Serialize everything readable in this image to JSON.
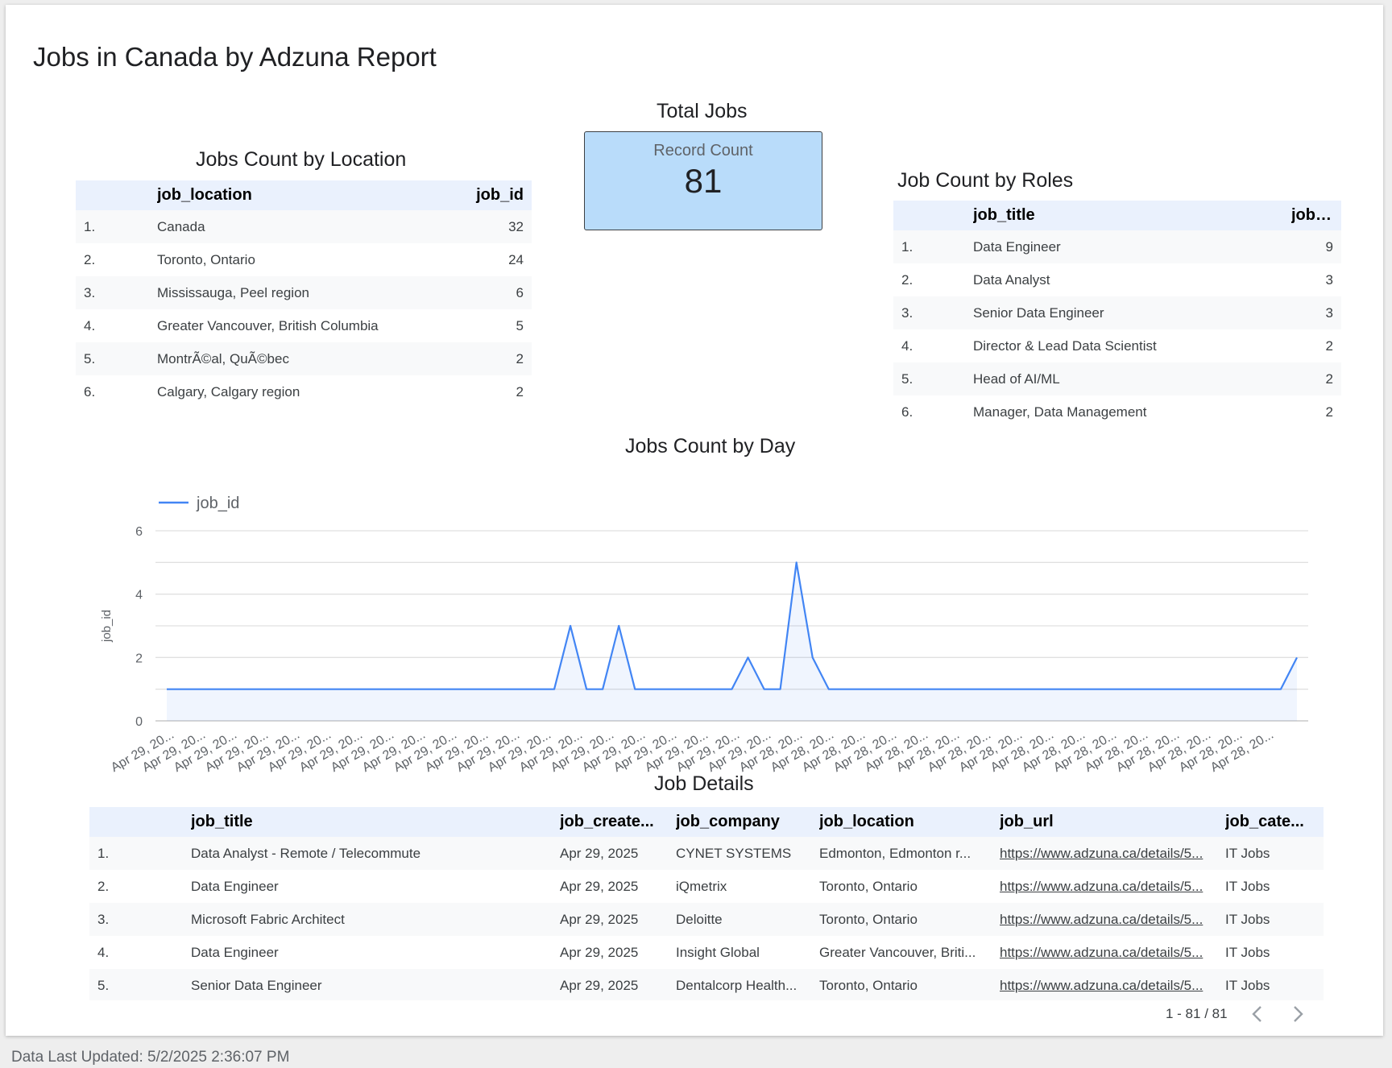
{
  "report": {
    "title": "Jobs in Canada by Adzuna Report",
    "footer": "Data Last Updated: 5/2/2025 2:36:07 PM"
  },
  "location_table": {
    "title": "Jobs Count by Location",
    "headers": [
      "job_location",
      "job_id"
    ],
    "rows": [
      {
        "idx": "1.",
        "location": "Canada",
        "count": "32"
      },
      {
        "idx": "2.",
        "location": "Toronto, Ontario",
        "count": "24"
      },
      {
        "idx": "3.",
        "location": "Mississauga, Peel region",
        "count": "6"
      },
      {
        "idx": "4.",
        "location": "Greater Vancouver, British Columbia",
        "count": "5"
      },
      {
        "idx": "5.",
        "location": "MontrÃ©al, QuÃ©bec",
        "count": "2"
      },
      {
        "idx": "6.",
        "location": "Calgary, Calgary region",
        "count": "2"
      }
    ]
  },
  "scorecard": {
    "title": "Total Jobs",
    "label": "Record Count",
    "value": "81"
  },
  "roles_table": {
    "title": "Job Count by Roles",
    "headers": [
      "job_title",
      "job_id"
    ],
    "rows": [
      {
        "idx": "1.",
        "title": "Data Engineer",
        "count": "9"
      },
      {
        "idx": "2.",
        "title": "Data Analyst",
        "count": "3"
      },
      {
        "idx": "3.",
        "title": "Senior Data Engineer",
        "count": "3"
      },
      {
        "idx": "4.",
        "title": "Director & Lead Data Scientist",
        "count": "2"
      },
      {
        "idx": "5.",
        "title": "Head of AI/ML",
        "count": "2"
      },
      {
        "idx": "6.",
        "title": "Manager, Data Management",
        "count": "2"
      }
    ]
  },
  "chart_data": {
    "type": "line",
    "title": "Jobs Count by Day",
    "ylabel": "job_id",
    "xlabel": "",
    "legend": "top-left",
    "ylim": [
      0,
      6
    ],
    "yticks": [
      0,
      2,
      4,
      6
    ],
    "grid": true,
    "x": [
      "Apr 29, 20...",
      "Apr 29, 20...",
      "Apr 29, 20...",
      "Apr 29, 20...",
      "Apr 29, 20...",
      "Apr 29, 20...",
      "Apr 29, 20...",
      "Apr 29, 20...",
      "Apr 29, 20...",
      "Apr 29, 20...",
      "Apr 29, 20...",
      "Apr 29, 20...",
      "Apr 29, 20...",
      "Apr 29, 20...",
      "Apr 29, 20...",
      "Apr 29, 20...",
      "Apr 29, 20...",
      "Apr 29, 20...",
      "Apr 29, 20...",
      "Apr 29, 20...",
      "Apr 28, 20...",
      "Apr 28, 20...",
      "Apr 28, 20...",
      "Apr 28, 20...",
      "Apr 28, 20...",
      "Apr 28, 20...",
      "Apr 28, 20...",
      "Apr 28, 20...",
      "Apr 28, 20...",
      "Apr 28, 20...",
      "Apr 28, 20...",
      "Apr 28, 20...",
      "Apr 28, 20...",
      "Apr 28, 20...",
      "Apr 28, 20...",
      "Apr 28, 20..."
    ],
    "series": [
      {
        "name": "job_id",
        "color": "#4285f4",
        "values": [
          1,
          1,
          1,
          1,
          1,
          1,
          1,
          1,
          1,
          1,
          1,
          1,
          1,
          1,
          1,
          1,
          1,
          1,
          1,
          1,
          1,
          1,
          1,
          1,
          1,
          3,
          1,
          1,
          3,
          1,
          1,
          1,
          1,
          1,
          1,
          1,
          2,
          1,
          1,
          5,
          2,
          1,
          1,
          1,
          1,
          1,
          1,
          1,
          1,
          1,
          1,
          1,
          1,
          1,
          1,
          1,
          1,
          1,
          1,
          1,
          1,
          1,
          1,
          1,
          1,
          1,
          1,
          1,
          1,
          1,
          2
        ]
      }
    ]
  },
  "details_table": {
    "title": "Job Details",
    "headers": [
      "job_title",
      "job_create...",
      "job_company",
      "job_location",
      "job_url",
      "job_cate..."
    ],
    "rows": [
      {
        "idx": "1.",
        "title": "Data Analyst - Remote / Telecommute",
        "created": "Apr 29, 2025",
        "company": "CYNET SYSTEMS",
        "location": "Edmonton, Edmonton r...",
        "url": "https://www.adzuna.ca/details/5...",
        "category": "IT Jobs"
      },
      {
        "idx": "2.",
        "title": "Data Engineer",
        "created": "Apr 29, 2025",
        "company": "iQmetrix",
        "location": "Toronto, Ontario",
        "url": "https://www.adzuna.ca/details/5...",
        "category": "IT Jobs"
      },
      {
        "idx": "3.",
        "title": "Microsoft Fabric Architect",
        "created": "Apr 29, 2025",
        "company": "Deloitte",
        "location": "Toronto, Ontario",
        "url": "https://www.adzuna.ca/details/5...",
        "category": "IT Jobs"
      },
      {
        "idx": "4.",
        "title": "Data Engineer",
        "created": "Apr 29, 2025",
        "company": "Insight Global",
        "location": "Greater Vancouver, Briti...",
        "url": "https://www.adzuna.ca/details/5...",
        "category": "IT Jobs"
      },
      {
        "idx": "5.",
        "title": "Senior Data Engineer",
        "created": "Apr 29, 2025",
        "company": "Dentalcorp Health...",
        "location": "Toronto, Ontario",
        "url": "https://www.adzuna.ca/details/5...",
        "category": "IT Jobs"
      }
    ],
    "pagination": "1 - 81 / 81"
  },
  "icons": {
    "prev": "chevron-left-icon",
    "next": "chevron-right-icon"
  }
}
